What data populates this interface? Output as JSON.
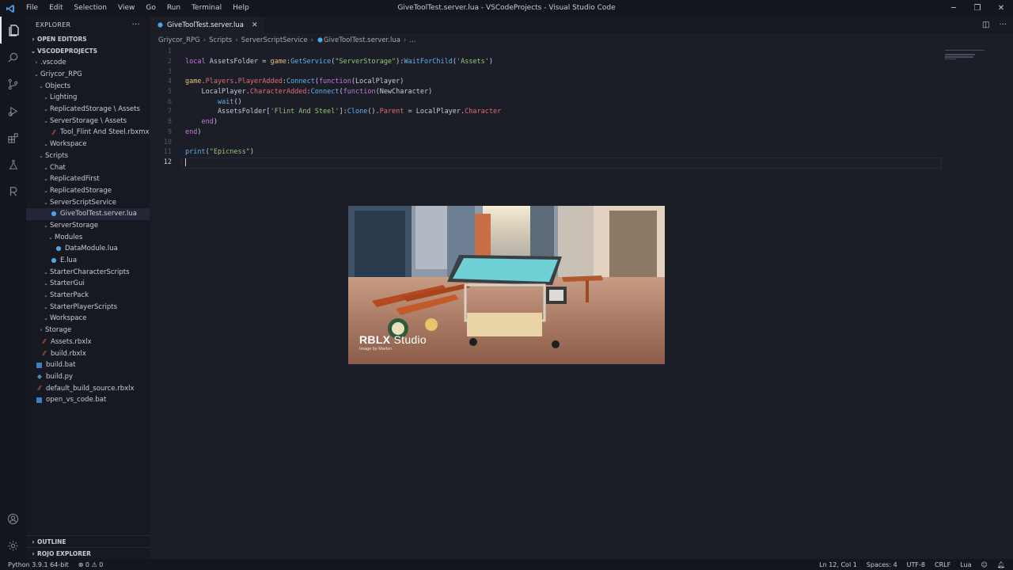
{
  "menu": [
    "File",
    "Edit",
    "Selection",
    "View",
    "Go",
    "Run",
    "Terminal",
    "Help"
  ],
  "window_title": "GiveToolTest.server.lua - VSCodeProjects - Visual Studio Code",
  "sidebar": {
    "title": "EXPLORER",
    "open_editors": "OPEN EDITORS",
    "workspace": "VSCODEPROJECTS",
    "tree": [
      {
        "label": ".vscode",
        "indent": 1,
        "chev": "›",
        "icon": ""
      },
      {
        "label": "Griycor_RPG",
        "indent": 1,
        "chev": "⌄",
        "icon": ""
      },
      {
        "label": "Objects",
        "indent": 2,
        "chev": "⌄",
        "icon": ""
      },
      {
        "label": "Lighting",
        "indent": 3,
        "chev": "⌄",
        "icon": ""
      },
      {
        "label": "ReplicatedStorage \\ Assets",
        "indent": 3,
        "chev": "⌄",
        "icon": ""
      },
      {
        "label": "ServerStorage \\ Assets",
        "indent": 3,
        "chev": "⌄",
        "icon": ""
      },
      {
        "label": "Tool_Flint And Steel.rbxmx",
        "indent": 4,
        "chev": "",
        "icon": "rbx"
      },
      {
        "label": "Workspace",
        "indent": 3,
        "chev": "⌄",
        "icon": ""
      },
      {
        "label": "Scripts",
        "indent": 2,
        "chev": "⌄",
        "icon": ""
      },
      {
        "label": "Chat",
        "indent": 3,
        "chev": "⌄",
        "icon": ""
      },
      {
        "label": "ReplicatedFirst",
        "indent": 3,
        "chev": "⌄",
        "icon": ""
      },
      {
        "label": "ReplicatedStorage",
        "indent": 3,
        "chev": "⌄",
        "icon": ""
      },
      {
        "label": "ServerScriptService",
        "indent": 3,
        "chev": "⌄",
        "icon": ""
      },
      {
        "label": "GiveToolTest.server.lua",
        "indent": 4,
        "chev": "",
        "icon": "lua",
        "selected": true
      },
      {
        "label": "ServerStorage",
        "indent": 3,
        "chev": "⌄",
        "icon": ""
      },
      {
        "label": "Modules",
        "indent": 4,
        "chev": "⌄",
        "icon": ""
      },
      {
        "label": "DataModule.lua",
        "indent": 5,
        "chev": "",
        "icon": "lua"
      },
      {
        "label": "E.lua",
        "indent": 4,
        "chev": "",
        "icon": "lua"
      },
      {
        "label": "StarterCharacterScripts",
        "indent": 3,
        "chev": "⌄",
        "icon": ""
      },
      {
        "label": "StarterGui",
        "indent": 3,
        "chev": "⌄",
        "icon": ""
      },
      {
        "label": "StarterPack",
        "indent": 3,
        "chev": "⌄",
        "icon": ""
      },
      {
        "label": "StarterPlayerScripts",
        "indent": 3,
        "chev": "⌄",
        "icon": ""
      },
      {
        "label": "Workspace",
        "indent": 3,
        "chev": "⌄",
        "icon": ""
      },
      {
        "label": "Storage",
        "indent": 2,
        "chev": "›",
        "icon": ""
      },
      {
        "label": "Assets.rbxlx",
        "indent": 2,
        "chev": "",
        "icon": "rbx"
      },
      {
        "label": "build.rbxlx",
        "indent": 2,
        "chev": "",
        "icon": "rbx"
      },
      {
        "label": "build.bat",
        "indent": 1,
        "chev": "",
        "icon": "bat"
      },
      {
        "label": "build.py",
        "indent": 1,
        "chev": "",
        "icon": "py"
      },
      {
        "label": "default_build_source.rbxlx",
        "indent": 1,
        "chev": "",
        "icon": "rbx"
      },
      {
        "label": "open_vs_code.bat",
        "indent": 1,
        "chev": "",
        "icon": "bat"
      }
    ],
    "outline": "OUTLINE",
    "rojo": "ROJO EXPLORER"
  },
  "editor": {
    "tab": "GiveToolTest.server.lua",
    "breadcrumb": [
      "Griycor_RPG",
      "Scripts",
      "ServerScriptService",
      "GiveToolTest.server.lua",
      "..."
    ],
    "code_lines": [
      {
        "n": "1",
        "tokens": []
      },
      {
        "n": "2",
        "tokens": [
          [
            "kw",
            "local "
          ],
          [
            "var",
            "AssetsFolder = "
          ],
          [
            "obj",
            "game"
          ],
          [
            "var",
            ":"
          ],
          [
            "fn",
            "GetService"
          ],
          [
            "var",
            "("
          ],
          [
            "str",
            "\"ServerStorage\""
          ],
          [
            "var",
            "):"
          ],
          [
            "fn",
            "WaitForChild"
          ],
          [
            "var",
            "("
          ],
          [
            "str",
            "'Assets'"
          ],
          [
            "var",
            ")"
          ]
        ]
      },
      {
        "n": "3",
        "tokens": []
      },
      {
        "n": "4",
        "tokens": [
          [
            "obj",
            "game"
          ],
          [
            "var",
            "."
          ],
          [
            "prop",
            "Players"
          ],
          [
            "var",
            "."
          ],
          [
            "prop",
            "PlayerAdded"
          ],
          [
            "var",
            ":"
          ],
          [
            "fn",
            "Connect"
          ],
          [
            "var",
            "("
          ],
          [
            "kw",
            "function"
          ],
          [
            "var",
            "(LocalPlayer)"
          ]
        ]
      },
      {
        "n": "5",
        "tokens": [
          [
            "var",
            "    LocalPlayer."
          ],
          [
            "prop",
            "CharacterAdded"
          ],
          [
            "var",
            ":"
          ],
          [
            "fn",
            "Connect"
          ],
          [
            "var",
            "("
          ],
          [
            "kw",
            "function"
          ],
          [
            "var",
            "(NewCharacter)"
          ]
        ]
      },
      {
        "n": "6",
        "tokens": [
          [
            "var",
            "        "
          ],
          [
            "fn",
            "wait"
          ],
          [
            "var",
            "()"
          ]
        ]
      },
      {
        "n": "7",
        "tokens": [
          [
            "var",
            "        AssetsFolder["
          ],
          [
            "str",
            "'Flint And Steel'"
          ],
          [
            "var",
            "]:"
          ],
          [
            "fn",
            "Clone"
          ],
          [
            "var",
            "()."
          ],
          [
            "prop",
            "Parent"
          ],
          [
            "var",
            " = LocalPlayer."
          ],
          [
            "prop",
            "Character"
          ]
        ]
      },
      {
        "n": "8",
        "tokens": [
          [
            "var",
            "    "
          ],
          [
            "kw",
            "end"
          ],
          [
            "var",
            ")"
          ]
        ]
      },
      {
        "n": "9",
        "tokens": [
          [
            "kw",
            "end"
          ],
          [
            "var",
            ")"
          ]
        ]
      },
      {
        "n": "10",
        "tokens": []
      },
      {
        "n": "11",
        "tokens": [
          [
            "fn",
            "print"
          ],
          [
            "var",
            "("
          ],
          [
            "str",
            "\"Epicness\""
          ],
          [
            "var",
            ")"
          ]
        ]
      },
      {
        "n": "12",
        "tokens": [],
        "current": true
      }
    ]
  },
  "splash": {
    "brand": "RBLX",
    "brand_suffix": "Studio",
    "credit": "Image by Martxn"
  },
  "status": {
    "python": "Python 3.9.1 64-bit",
    "problems": "⊗ 0 ⚠ 0",
    "position": "Ln 12, Col 1",
    "spaces": "Spaces: 4",
    "encoding": "UTF-8",
    "eol": "CRLF",
    "language": "Lua"
  }
}
